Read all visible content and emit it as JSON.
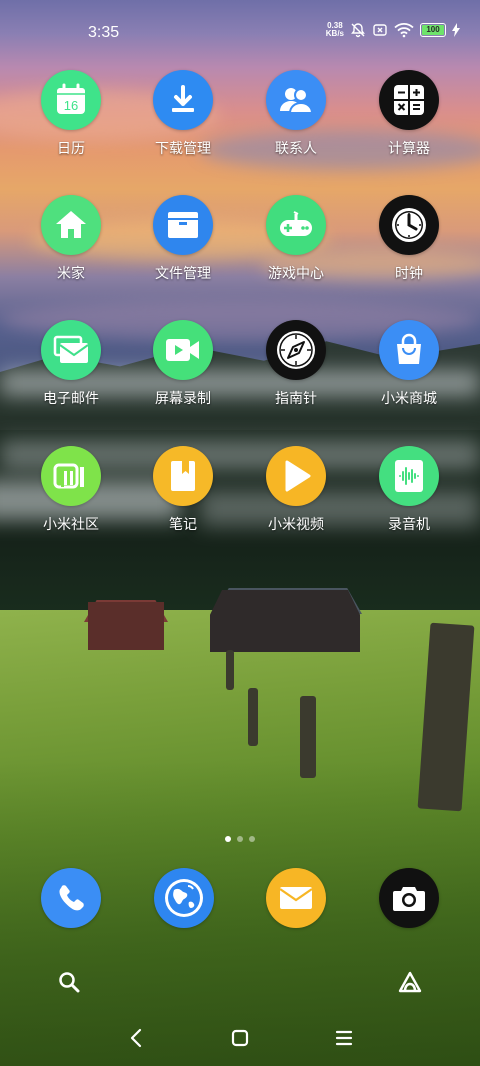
{
  "status_bar": {
    "time": "3:35",
    "netspeed_value": "0.38",
    "netspeed_unit": "KB/s",
    "battery_level": "100"
  },
  "apps": [
    {
      "label": "日历",
      "icon": "calendar-icon",
      "icon_text": "16",
      "color": "#3fe38a"
    },
    {
      "label": "下载管理",
      "icon": "download-icon",
      "color": "#2e8bf2"
    },
    {
      "label": "联系人",
      "icon": "contacts-icon",
      "color": "#3b8ef5"
    },
    {
      "label": "计算器",
      "icon": "calculator-icon",
      "color": "#111111"
    },
    {
      "label": "米家",
      "icon": "home-icon",
      "color": "#4fe07e"
    },
    {
      "label": "文件管理",
      "icon": "folder-icon",
      "color": "#2f86ee"
    },
    {
      "label": "游戏中心",
      "icon": "gamepad-icon",
      "color": "#41dd7e"
    },
    {
      "label": "时钟",
      "icon": "clock-icon",
      "color": "#111111"
    },
    {
      "label": "电子邮件",
      "icon": "email-icon",
      "color": "#3fe08a"
    },
    {
      "label": "屏幕录制",
      "icon": "screen-record-icon",
      "color": "#45e07a"
    },
    {
      "label": "指南针",
      "icon": "compass-icon",
      "color": "#111111"
    },
    {
      "label": "小米商城",
      "icon": "shopping-bag-icon",
      "color": "#3b8ef5"
    },
    {
      "label": "小米社区",
      "icon": "mi-community-icon",
      "icon_text": "MI",
      "color": "#7fe34a"
    },
    {
      "label": "笔记",
      "icon": "notes-icon",
      "color": "#f6b928"
    },
    {
      "label": "小米视频",
      "icon": "video-play-icon",
      "color": "#f7b625"
    },
    {
      "label": "录音机",
      "icon": "recorder-icon",
      "color": "#44df80"
    }
  ],
  "dock": [
    {
      "name": "phone",
      "icon": "phone-icon",
      "color": "#3b8ef5"
    },
    {
      "name": "browser",
      "icon": "globe-icon",
      "color": "#2e86f0"
    },
    {
      "name": "messages",
      "icon": "envelope-icon",
      "color": "#f7b625"
    },
    {
      "name": "camera",
      "icon": "camera-icon",
      "color": "#111111"
    }
  ],
  "page_indicator": {
    "count": 3,
    "active": 0
  }
}
